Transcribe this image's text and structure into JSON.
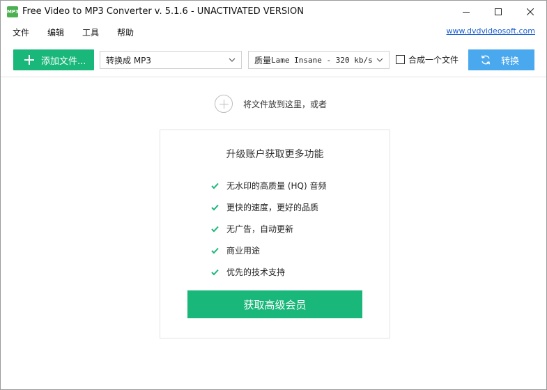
{
  "window": {
    "app_icon_text": "MP3",
    "title": "Free Video to MP3 Converter v. 5.1.6 - UNACTIVATED VERSION"
  },
  "menu": {
    "items": [
      "文件",
      "编辑",
      "工具",
      "帮助"
    ],
    "website_link": "www.dvdvideosoft.com"
  },
  "toolbar": {
    "add_files_label": "添加文件...",
    "format_select": "转换成 MP3",
    "quality_label": "质量",
    "quality_value": "Lame Insane - 320 kb/s",
    "merge_label": "合成一个文件",
    "merge_checked": false,
    "convert_label": "转换"
  },
  "dropzone": {
    "text": "将文件放到这里，或者"
  },
  "upgrade": {
    "title": "升级账户获取更多功能",
    "features": [
      "无水印的高质量 (HQ) 音频",
      "更快的速度，更好的品质",
      "无广告，自动更新",
      "商业用途",
      "优先的技术支持"
    ],
    "button_label": "获取高级会员"
  },
  "colors": {
    "accent_green": "#1ab77a",
    "accent_blue": "#4aa8ee",
    "link_blue": "#1a5fd0"
  },
  "icons": [
    "app-icon",
    "minimize-icon",
    "maximize-icon",
    "close-icon",
    "plus-icon",
    "chevron-down-icon",
    "refresh-icon",
    "add-circle-icon",
    "check-icon"
  ]
}
